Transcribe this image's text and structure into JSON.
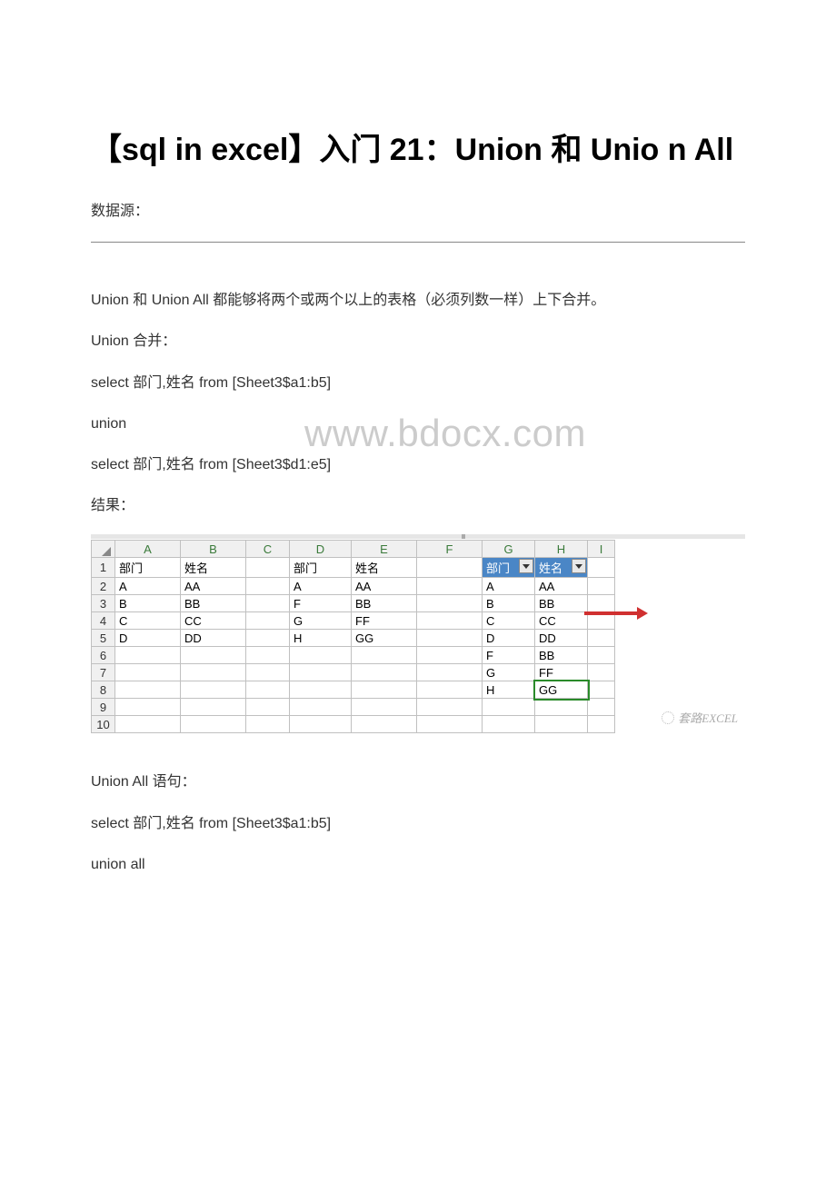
{
  "title": "【sql in excel】入门 21：Union 和 Unio n All",
  "p1": "数据源：",
  "p2": "Union 和 Union All 都能够将两个或两个以上的表格（必须列数一样）上下合并。",
  "p3": "Union 合并：",
  "p4": "select 部门,姓名 from [Sheet3$a1:b5]",
  "p5": "union",
  "p6": "select 部门,姓名 from [Sheet3$d1:e5]",
  "p7": "结果：",
  "watermark": "www.bdocx.com",
  "p8": "Union All 语句：",
  "p9": "select 部门,姓名 from [Sheet3$a1:b5]",
  "p10": "union all",
  "sheet": {
    "cols": [
      "A",
      "B",
      "C",
      "D",
      "E",
      "F",
      "G",
      "H",
      "I"
    ],
    "rows": [
      "1",
      "2",
      "3",
      "4",
      "5",
      "6",
      "7",
      "8",
      "9",
      "10"
    ],
    "headerAB": {
      "A": "部门",
      "B": "姓名"
    },
    "dataAB": [
      {
        "A": "A",
        "B": "AA"
      },
      {
        "A": "B",
        "B": "BB"
      },
      {
        "A": "C",
        "B": "CC"
      },
      {
        "A": "D",
        "B": "DD"
      }
    ],
    "headerDE": {
      "D": "部门",
      "E": "姓名"
    },
    "dataDE": [
      {
        "D": "A",
        "E": "AA"
      },
      {
        "D": "F",
        "E": "BB"
      },
      {
        "D": "G",
        "E": "FF"
      },
      {
        "D": "H",
        "E": "GG"
      }
    ],
    "headerGH": {
      "G": "部门",
      "H": "姓名"
    },
    "dataGH": [
      {
        "G": "A",
        "H": "AA"
      },
      {
        "G": "B",
        "H": "BB"
      },
      {
        "G": "C",
        "H": "CC"
      },
      {
        "G": "D",
        "H": "DD"
      },
      {
        "G": "F",
        "H": "BB"
      },
      {
        "G": "G",
        "H": "FF"
      },
      {
        "G": "H",
        "H": "GG"
      }
    ],
    "logo": "套路EXCEL"
  }
}
